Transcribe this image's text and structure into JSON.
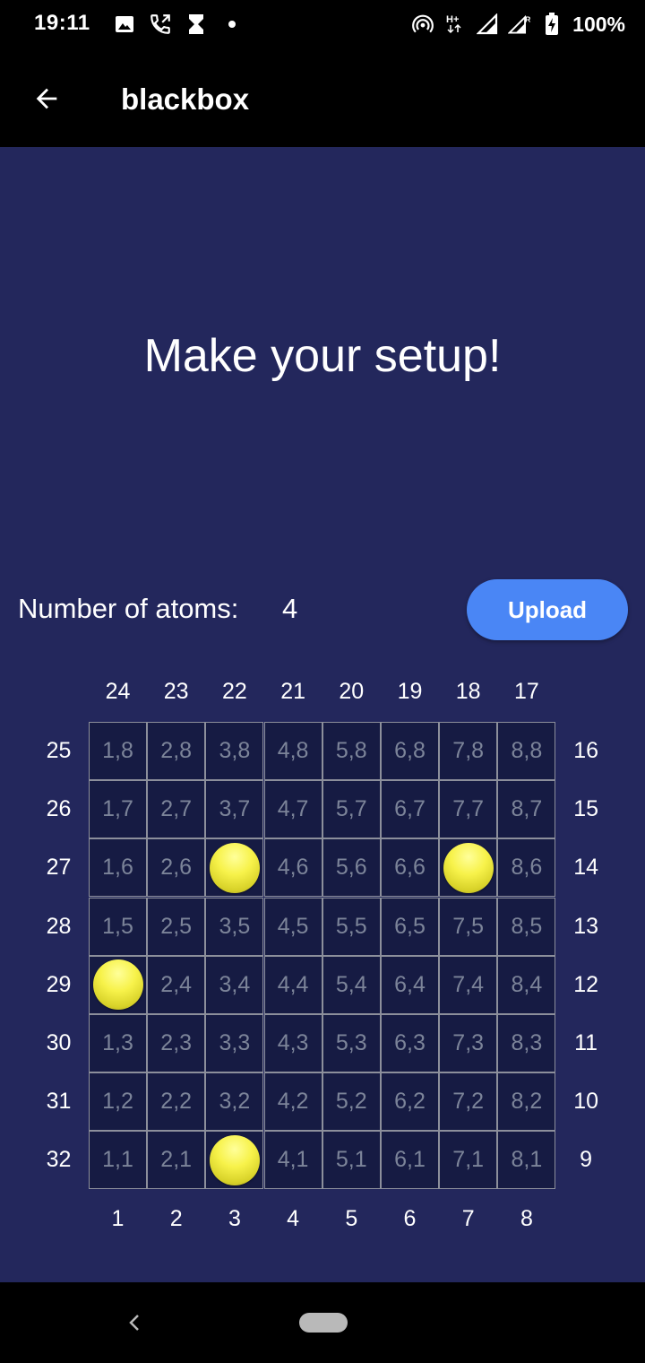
{
  "status_bar": {
    "time": "19:11",
    "left_icons": [
      "image-icon",
      "call-forward-icon",
      "hourglass-icon",
      "dot-icon"
    ],
    "right_icons": [
      "hotspot-icon",
      "hplus-data-icon",
      "signal-icon",
      "signal-roaming-icon",
      "battery-charging-icon"
    ],
    "battery": "100%"
  },
  "app_bar": {
    "title": "blackbox"
  },
  "headline": "Make your setup!",
  "atoms": {
    "label": "Number of atoms:",
    "count": "4"
  },
  "upload_label": "Upload",
  "board": {
    "top_numbers": [
      "24",
      "23",
      "22",
      "21",
      "20",
      "19",
      "18",
      "17"
    ],
    "left_numbers": [
      "25",
      "26",
      "27",
      "28",
      "29",
      "30",
      "31",
      "32"
    ],
    "right_numbers": [
      "16",
      "15",
      "14",
      "13",
      "12",
      "11",
      "10",
      "9"
    ],
    "bottom_numbers": [
      "1",
      "2",
      "3",
      "4",
      "5",
      "6",
      "7",
      "8"
    ],
    "rows": [
      [
        "1,8",
        "2,8",
        "3,8",
        "4,8",
        "5,8",
        "6,8",
        "7,8",
        "8,8"
      ],
      [
        "1,7",
        "2,7",
        "3,7",
        "4,7",
        "5,7",
        "6,7",
        "7,7",
        "8,7"
      ],
      [
        "1,6",
        "2,6",
        "3,6",
        "4,6",
        "5,6",
        "6,6",
        "7,6",
        "8,6"
      ],
      [
        "1,5",
        "2,5",
        "3,5",
        "4,5",
        "5,5",
        "6,5",
        "7,5",
        "8,5"
      ],
      [
        "1,4",
        "2,4",
        "3,4",
        "4,4",
        "5,4",
        "6,4",
        "7,4",
        "8,4"
      ],
      [
        "1,3",
        "2,3",
        "3,3",
        "4,3",
        "5,3",
        "6,3",
        "7,3",
        "8,3"
      ],
      [
        "1,2",
        "2,2",
        "3,2",
        "4,2",
        "5,2",
        "6,2",
        "7,2",
        "8,2"
      ],
      [
        "1,1",
        "2,1",
        "3,1",
        "4,1",
        "5,1",
        "6,1",
        "7,1",
        "8,1"
      ]
    ],
    "atom_cells": [
      "3,6",
      "7,6",
      "1,4",
      "3,1"
    ],
    "colors": {
      "background": "#23275c",
      "cell": "#161b43",
      "cell_text": "#7c8499",
      "atom": "#f7f24a",
      "button": "#4a86f5"
    }
  }
}
